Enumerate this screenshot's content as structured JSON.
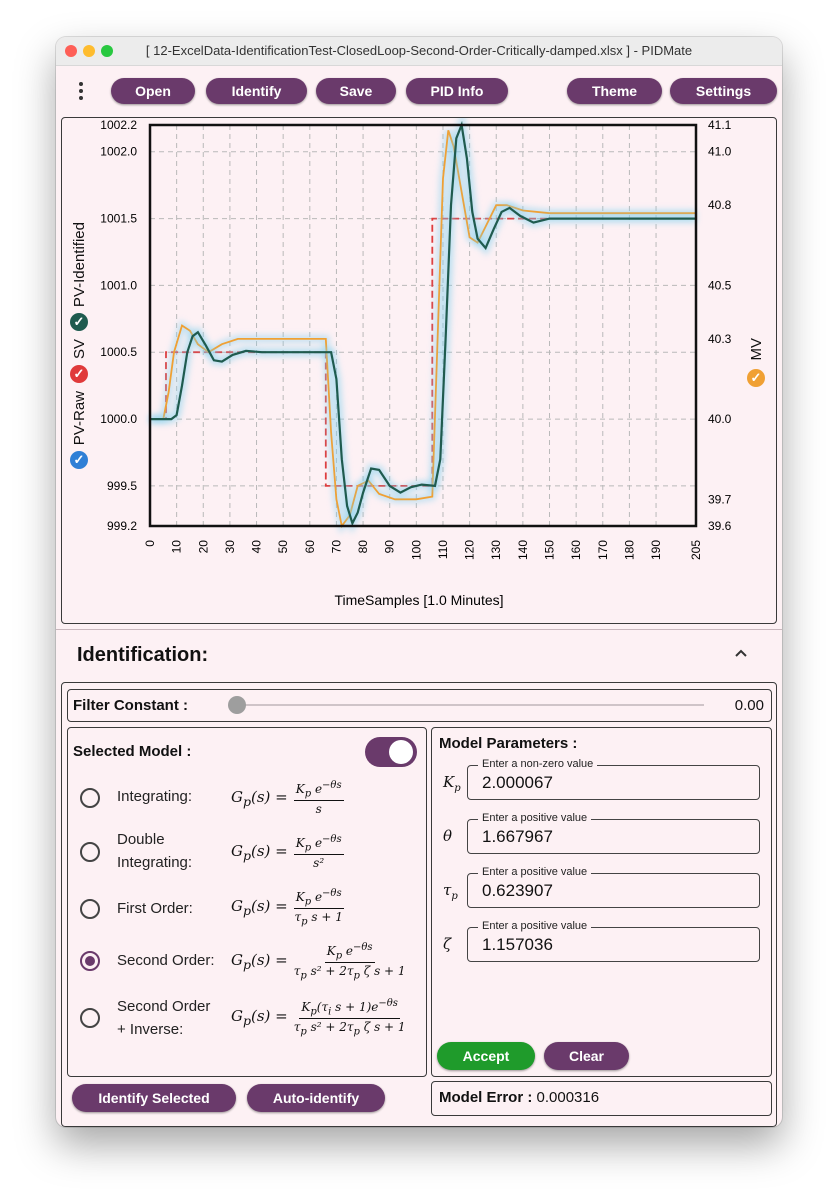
{
  "window": {
    "title": "[ 12-ExcelData-IdentificationTest-ClosedLoop-Second-Order-Critically-damped.xlsx ]  -  PIDMate"
  },
  "toolbar": {
    "menu_icon": "kebab-menu-icon",
    "open": "Open",
    "identify": "Identify",
    "save": "Save",
    "pid_info": "PID Info",
    "theme": "Theme",
    "settings": "Settings"
  },
  "legend": {
    "pv_raw": "PV-Raw",
    "sv": "SV",
    "pv_identified": "PV-Identified",
    "mv": "MV",
    "colors": {
      "pv_raw": "#2f7fd6",
      "sv": "#e03a3a",
      "pv_identified": "#1f5b4f",
      "mv": "#f0a033"
    }
  },
  "chart_data": {
    "type": "line",
    "xlabel": "TimeSamples [1.0 Minutes]",
    "xlim": [
      0,
      205
    ],
    "x_ticks": [
      0,
      10,
      20,
      30,
      40,
      50,
      60,
      70,
      80,
      90,
      100,
      110,
      120,
      130,
      140,
      150,
      160,
      170,
      180,
      190,
      205
    ],
    "y_left_range": [
      999.2,
      1002.2
    ],
    "y_left_ticks": [
      999.2,
      999.5,
      1000.0,
      1000.5,
      1001.0,
      1001.5,
      1002.0,
      1002.2
    ],
    "y_right_range": [
      39.6,
      41.1
    ],
    "y_right_ticks": [
      39.6,
      39.7,
      40.0,
      40.3,
      40.5,
      40.8,
      41.0,
      41.1
    ],
    "grid": true,
    "series": [
      {
        "name": "SV",
        "style": "dashed",
        "color": "#e03a3a",
        "points": [
          [
            0,
            1000.0
          ],
          [
            6,
            1000.0
          ],
          [
            6,
            1000.5
          ],
          [
            66,
            1000.5
          ],
          [
            66,
            999.5
          ],
          [
            106,
            999.5
          ],
          [
            106,
            1001.5
          ],
          [
            205,
            1001.5
          ]
        ]
      },
      {
        "name": "PV-Identified",
        "color": "#1f5b4f",
        "points": [
          [
            0,
            1000.0
          ],
          [
            8,
            1000.0
          ],
          [
            10,
            1000.03
          ],
          [
            12,
            1000.25
          ],
          [
            14,
            1000.5
          ],
          [
            16,
            1000.62
          ],
          [
            18,
            1000.65
          ],
          [
            21,
            1000.55
          ],
          [
            24,
            1000.44
          ],
          [
            27,
            1000.43
          ],
          [
            31,
            1000.48
          ],
          [
            36,
            1000.51
          ],
          [
            42,
            1000.5
          ],
          [
            50,
            1000.5
          ],
          [
            60,
            1000.5
          ],
          [
            68,
            1000.5
          ],
          [
            70,
            1000.3
          ],
          [
            72,
            999.7
          ],
          [
            74,
            999.35
          ],
          [
            76,
            999.22
          ],
          [
            78,
            999.3
          ],
          [
            80,
            999.45
          ],
          [
            83,
            999.63
          ],
          [
            86,
            999.62
          ],
          [
            90,
            999.5
          ],
          [
            94,
            999.45
          ],
          [
            98,
            999.49
          ],
          [
            102,
            999.51
          ],
          [
            107,
            999.5
          ],
          [
            109,
            999.7
          ],
          [
            111,
            1000.6
          ],
          [
            113,
            1001.6
          ],
          [
            115,
            1002.1
          ],
          [
            117,
            1002.2
          ],
          [
            119,
            1001.95
          ],
          [
            121,
            1001.55
          ],
          [
            123,
            1001.35
          ],
          [
            126,
            1001.28
          ],
          [
            129,
            1001.42
          ],
          [
            132,
            1001.55
          ],
          [
            135,
            1001.58
          ],
          [
            139,
            1001.52
          ],
          [
            144,
            1001.47
          ],
          [
            150,
            1001.5
          ],
          [
            170,
            1001.5
          ],
          [
            205,
            1001.5
          ]
        ]
      },
      {
        "name": "MV",
        "color": "#f0a033",
        "points": [
          [
            0,
            40.0
          ],
          [
            5,
            40.0
          ],
          [
            7,
            40.1
          ],
          [
            9,
            40.25
          ],
          [
            12,
            40.35
          ],
          [
            15,
            40.33
          ],
          [
            18,
            40.28
          ],
          [
            22,
            40.25
          ],
          [
            27,
            40.28
          ],
          [
            33,
            40.3
          ],
          [
            40,
            40.3
          ],
          [
            50,
            40.3
          ],
          [
            62,
            40.3
          ],
          [
            66,
            40.3
          ],
          [
            68,
            39.95
          ],
          [
            70,
            39.7
          ],
          [
            72,
            39.6
          ],
          [
            75,
            39.64
          ],
          [
            78,
            39.75
          ],
          [
            82,
            39.77
          ],
          [
            86,
            39.72
          ],
          [
            92,
            39.7
          ],
          [
            100,
            39.7
          ],
          [
            106,
            39.71
          ],
          [
            108,
            40.3
          ],
          [
            110,
            40.9
          ],
          [
            112,
            41.08
          ],
          [
            114,
            41.02
          ],
          [
            117,
            40.85
          ],
          [
            120,
            40.68
          ],
          [
            123,
            40.66
          ],
          [
            126,
            40.72
          ],
          [
            130,
            40.8
          ],
          [
            134,
            40.8
          ],
          [
            140,
            40.78
          ],
          [
            150,
            40.77
          ],
          [
            205,
            40.77
          ]
        ]
      }
    ]
  },
  "identification": {
    "title": "Identification:",
    "collapse_icon": "chevron-up-icon",
    "filter_label": "Filter Constant :",
    "filter_value": "0.00",
    "filter_level": 0,
    "selected_model_title": "Selected Model :",
    "toggle_on": true,
    "models": [
      {
        "label": "Integrating:",
        "selected": false
      },
      {
        "label": "Double\nIntegrating:",
        "selected": false
      },
      {
        "label": "First Order:",
        "selected": false
      },
      {
        "label": "Second Order:",
        "selected": true
      },
      {
        "label": "Second Order\n+ Inverse:",
        "selected": false
      }
    ],
    "formulas": [
      {
        "lhs": "G",
        "sub": "p",
        "arg": "(s) =",
        "num": "K_p e^{−θs}",
        "den": "s"
      },
      {
        "lhs": "G",
        "sub": "p",
        "arg": "(s) =",
        "num": "K_p e^{−θs}",
        "den": "s²"
      },
      {
        "lhs": "G",
        "sub": "p",
        "arg": "(s) =",
        "num": "K_p e^{−θs}",
        "den": "τ_p s + 1"
      },
      {
        "lhs": "G",
        "sub": "p",
        "arg": "(s) =",
        "num": "K_p e^{−θs}",
        "den": "τ_p s² + 2τ_p ζ s + 1"
      },
      {
        "lhs": "G",
        "sub": "p",
        "arg": "(s) =",
        "num": "K_p(τ_i s + 1)e^{−θs}",
        "den": "τ_p s² + 2τ_p ζ s + 1"
      }
    ],
    "params_title": "Model Parameters :",
    "params": [
      {
        "symbol": "K",
        "sub": "p",
        "hint": "Enter a non-zero value",
        "value": "2.000067"
      },
      {
        "symbol": "θ",
        "sub": "",
        "hint": "Enter a positive value",
        "value": "1.667967"
      },
      {
        "symbol": "τ",
        "sub": "p",
        "hint": "Enter a positive value",
        "value": "0.623907"
      },
      {
        "symbol": "ζ",
        "sub": "",
        "hint": "Enter a positive value",
        "value": "1.157036"
      }
    ],
    "accept": "Accept",
    "clear": "Clear",
    "identify_selected": "Identify Selected",
    "auto_identify": "Auto-identify",
    "model_error_label": "Model Error :",
    "model_error_value": "0.000316"
  },
  "colors": {
    "accent": "#6a3a6b",
    "accept_green": "#1f9b2b",
    "background": "#fdf1f4"
  }
}
